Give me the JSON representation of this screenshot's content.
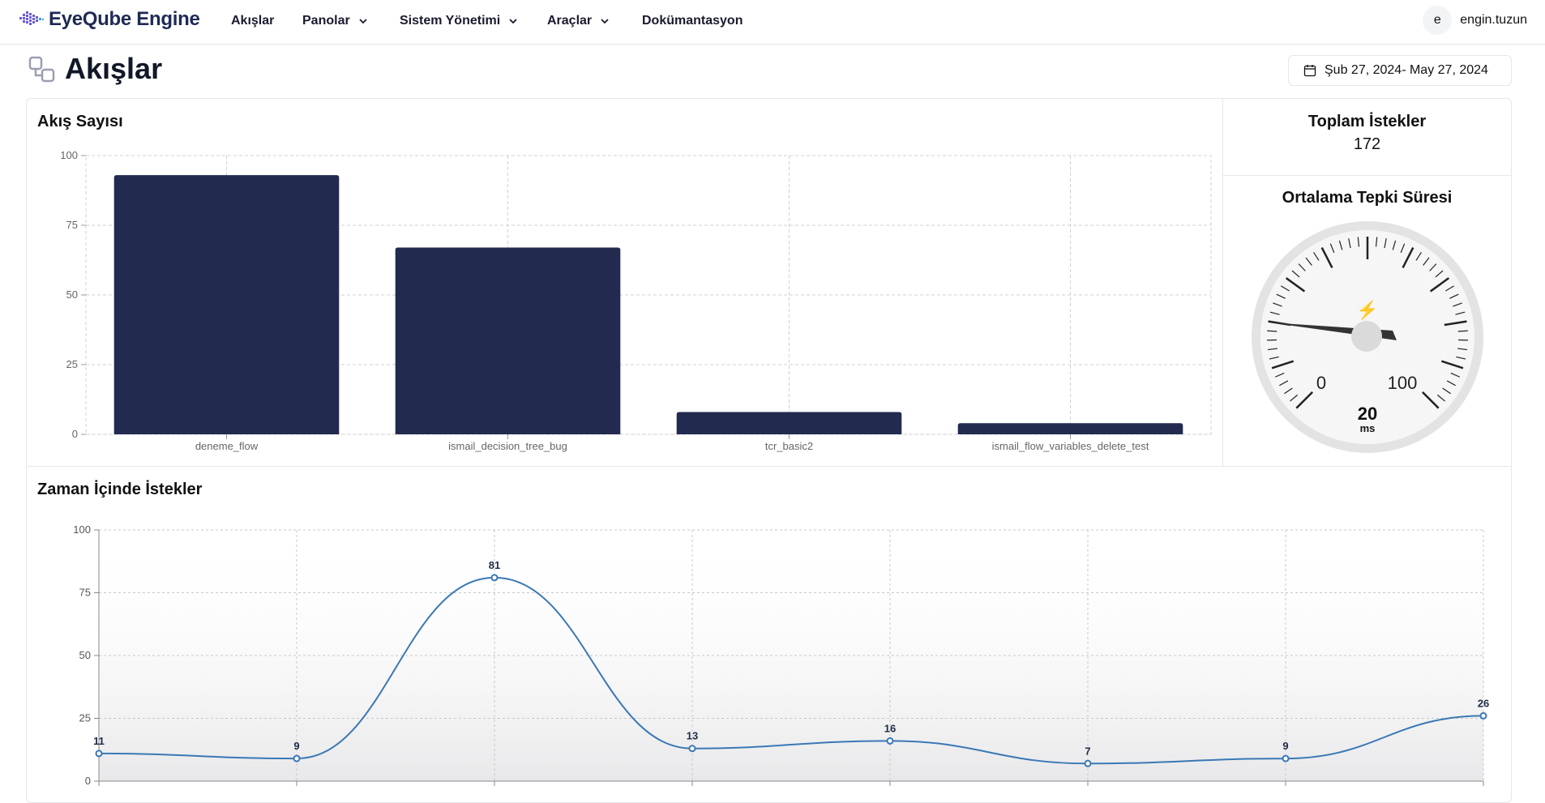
{
  "brand": {
    "name": "EyeQube Engine"
  },
  "nav": {
    "items": [
      {
        "label": "Akışlar",
        "dropdown": false
      },
      {
        "label": "Panolar",
        "dropdown": true
      },
      {
        "label": "Sistem Yönetimi",
        "dropdown": true
      },
      {
        "label": "Araçlar",
        "dropdown": true
      },
      {
        "label": "Dokümantasyon",
        "dropdown": false
      }
    ]
  },
  "user": {
    "initial": "e",
    "name": "engin.tuzun"
  },
  "page": {
    "title": "Akışlar",
    "date_range": "Şub 27, 2024- May 27, 2024"
  },
  "stats": {
    "total_title": "Toplam İstekler",
    "total_value": "172",
    "avg_title": "Ortalama Tepki Süresi",
    "gauge": {
      "value": "20",
      "unit": "ms",
      "tick_min": "0",
      "tick_max": "100"
    }
  },
  "colors": {
    "bar": "#232a50",
    "line": "#3a78b5",
    "border": "#e5e7eb",
    "gauge_icon": "#f5b942"
  },
  "chart_data": [
    {
      "type": "bar",
      "title": "Akış Sayısı",
      "categories": [
        "deneme_flow",
        "ismail_decision_tree_bug",
        "tcr_basic2",
        "ismail_flow_variables_delete_test"
      ],
      "values": [
        93,
        67,
        8,
        4
      ],
      "ylim": [
        0,
        100
      ],
      "yticks": [
        "0",
        "25",
        "50",
        "75",
        "100"
      ],
      "grid": true
    },
    {
      "type": "line",
      "title": "Zaman İçinde İstekler",
      "values": [
        11,
        9,
        81,
        13,
        16,
        7,
        9,
        26
      ],
      "data_labels": [
        "11",
        "9",
        "81",
        "13",
        "16",
        "7",
        "9",
        "26"
      ],
      "ylim": [
        0,
        100
      ],
      "yticks": [
        "0",
        "25",
        "50",
        "75",
        "100"
      ],
      "grid": true
    }
  ]
}
